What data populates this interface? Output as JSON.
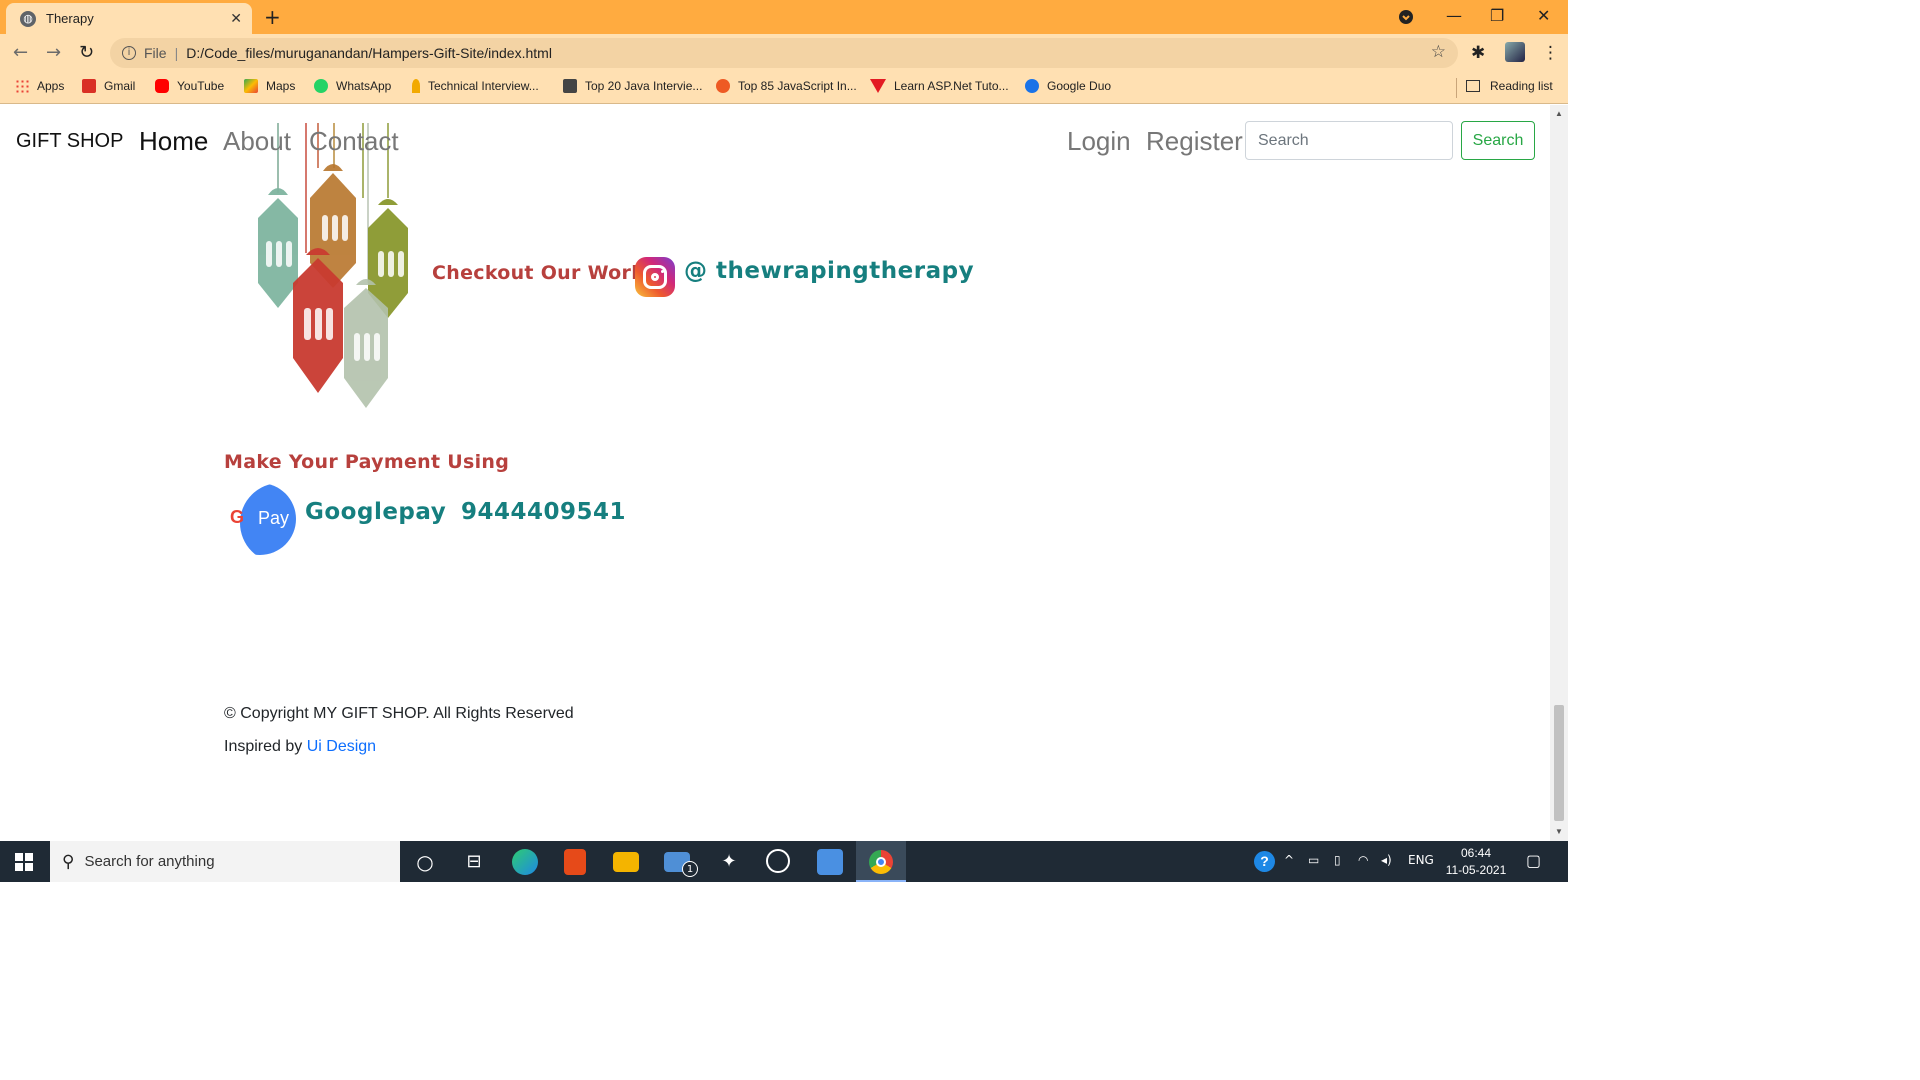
{
  "browser": {
    "tab_title": "Therapy",
    "tab_close": "✕",
    "new_tab": "+",
    "url_scheme": "File",
    "url": "D:/Code_files/muruganandan/Hampers-Gift-Site/index.html",
    "bookmarks": [
      {
        "label": "Apps",
        "color": "#e94235"
      },
      {
        "label": "Gmail",
        "color": "#d93025"
      },
      {
        "label": "YouTube",
        "color": "#ff0000"
      },
      {
        "label": "Maps",
        "color": "#34a853"
      },
      {
        "label": "WhatsApp",
        "color": "#25d366"
      },
      {
        "label": "Technical Interview...",
        "color": "#f2a900"
      },
      {
        "label": "Top 20 Java Intervie...",
        "color": "#444444"
      },
      {
        "label": "Top 85 JavaScript In...",
        "color": "#ee5a24"
      },
      {
        "label": "Learn ASP.Net Tuto...",
        "color": "#e31b23"
      },
      {
        "label": "Google Duo",
        "color": "#1a73e8"
      }
    ],
    "reading_list": "Reading list"
  },
  "navbar": {
    "brand": "GIFT SHOP",
    "links": [
      "Home",
      "About",
      "Contact"
    ],
    "login": "Login",
    "register": "Register",
    "search_placeholder": "Search",
    "search_button": "Search"
  },
  "content": {
    "checkout_text": "Checkout Our Work",
    "instagram_handle": "@ thewrapingtherapy",
    "payment_title": "Make Your Payment Using",
    "gpay_logo": "Pay",
    "payment_method": "Googlepay",
    "phone": "9444409541"
  },
  "footer": {
    "copyright": "© Copyright MY GIFT SHOP. All Rights Reserved",
    "inspired_prefix": "Inspired by",
    "inspired_link": "Ui Design"
  },
  "taskbar": {
    "search_placeholder": "Search for anything",
    "language": "ENG",
    "time": "06:44",
    "date": "11-05-2021",
    "mail_badge": "1"
  },
  "colors": {
    "tabstrip": "#ffab40",
    "toolbar": "#ffe0b2",
    "heading_red": "#b7403d",
    "teal": "#167f7f",
    "search_green": "#28a745"
  }
}
